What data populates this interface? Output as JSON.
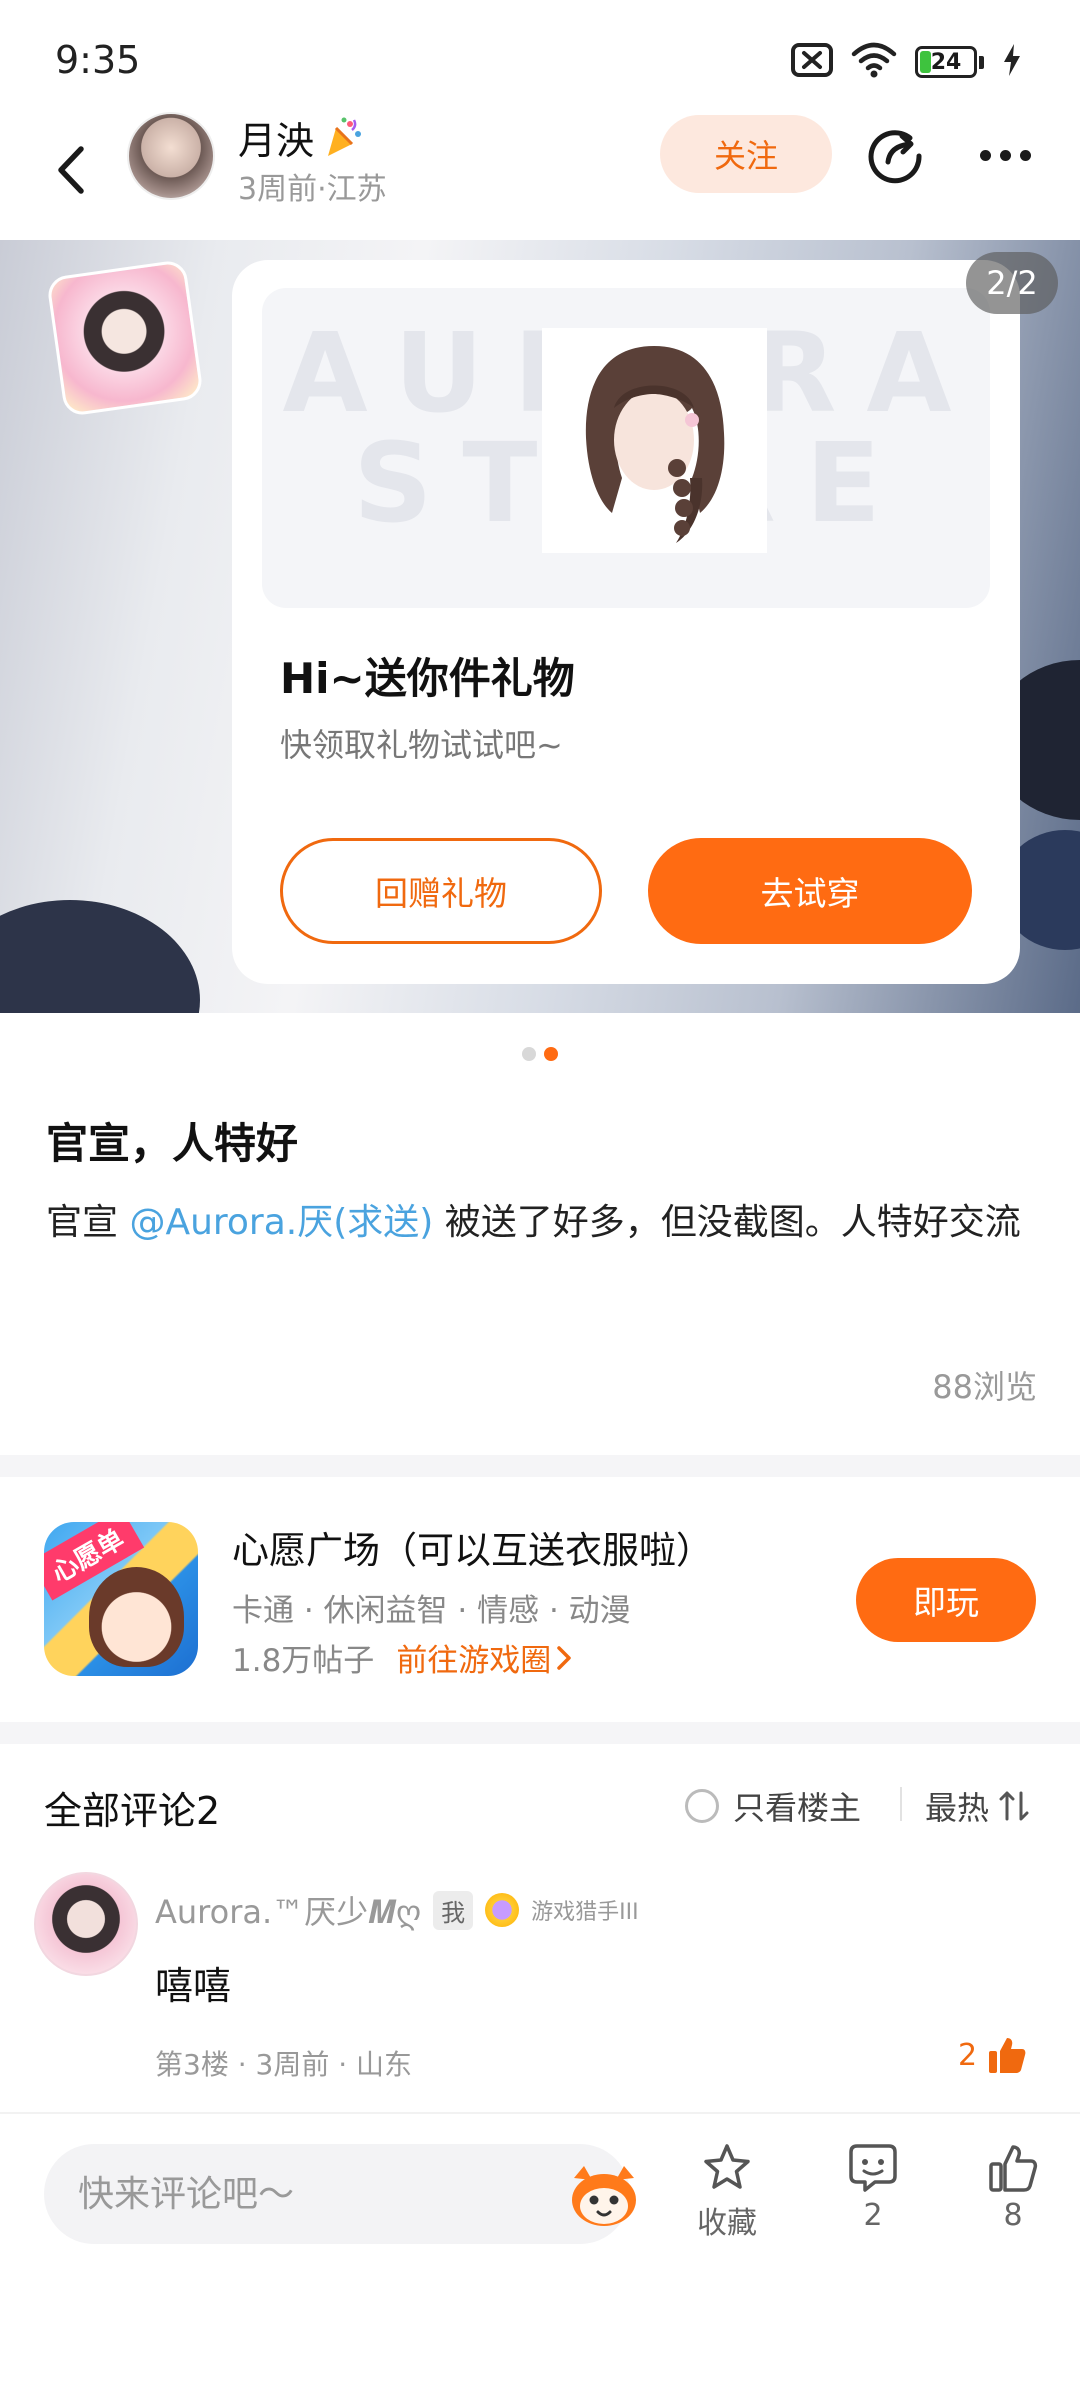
{
  "status_bar": {
    "time": "9:35",
    "battery": "24"
  },
  "header": {
    "user_name": "月泱",
    "user_meta": "3周前·江苏",
    "follow_label": "关注"
  },
  "carousel": {
    "page_counter": "2/2",
    "watermark_text": "AURORA STORE",
    "gift_title": "Hi~送你件礼物",
    "gift_subtitle": "快领取礼物试试吧~",
    "return_gift_label": "回赠礼物",
    "try_on_label": "去试穿",
    "total_pages": 2,
    "current_page": 2
  },
  "post": {
    "title": "官宣，人特好",
    "body_prefix": "官宣 ",
    "mention": "@Aurora.厌(求送)",
    "body_suffix": " 被送了好多，但没截图。人特好交流",
    "views": "88浏览"
  },
  "game": {
    "badge": "心愿单",
    "title": "心愿广场（可以互送衣服啦）",
    "tags": "卡通 · 休闲益智 · 情感 · 动漫",
    "posts": "1.8万帖子",
    "circle_link": "前往游戏圈",
    "play_label": "即玩"
  },
  "comments": {
    "title": "全部评论2",
    "owner_only_label": "只看楼主",
    "sort_label": "最热",
    "items": [
      {
        "user": "Aurora.™厌少𝑴ღ",
        "me_tag": "我",
        "level": "游戏猎手III",
        "text": "嘻嘻",
        "meta": "第3楼 · 3周前 · 山东",
        "likes": "2"
      }
    ]
  },
  "bottom_bar": {
    "input_placeholder": "快来评论吧～",
    "favorite_label": "收藏",
    "comment_count": "2",
    "like_count": "8"
  },
  "colors": {
    "accent": "#ff6b12",
    "link": "#4aa3df"
  },
  "icons": [
    "back-icon",
    "share-icon",
    "more-icon",
    "wifi-icon",
    "signal-off-icon",
    "charging-icon",
    "chevron-right-icon",
    "sort-icon",
    "thumb-up-icon",
    "star-icon",
    "comment-icon",
    "mascot-icon"
  ]
}
